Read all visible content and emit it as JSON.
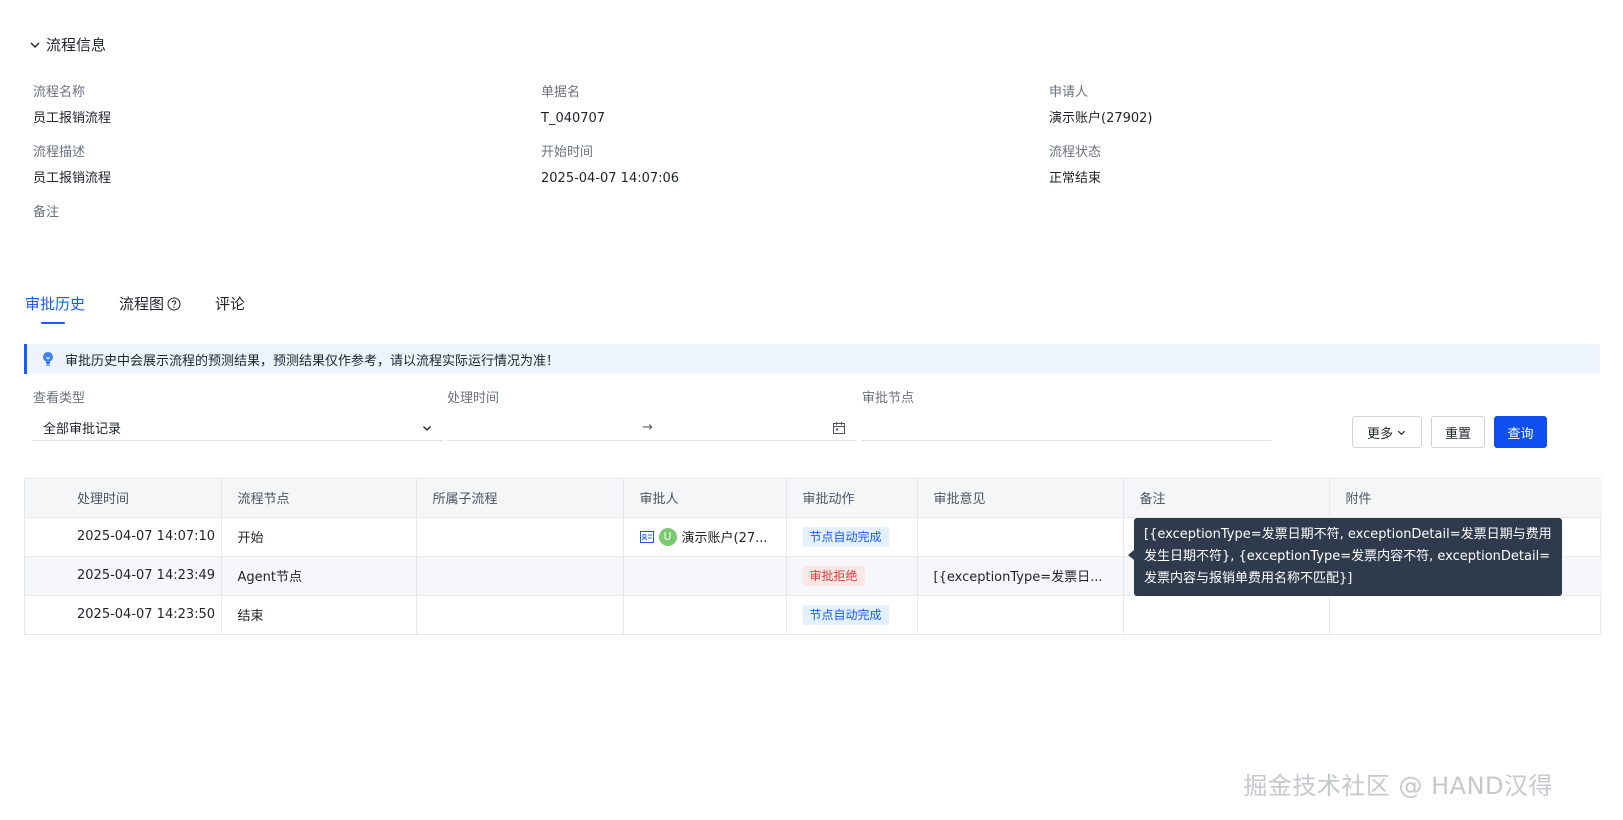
{
  "section": {
    "title": "流程信息",
    "icon": "chevron-down-icon"
  },
  "info": {
    "flow_name_label": "流程名称",
    "flow_name_value": "员工报销流程",
    "doc_name_label": "单据名",
    "doc_name_value": "T_040707",
    "applicant_label": "申请人",
    "applicant_value": "演示账户(27902)",
    "flow_desc_label": "流程描述",
    "flow_desc_value": "员工报销流程",
    "start_time_label": "开始时间",
    "start_time_value": "2025-04-07 14:07:06",
    "status_label": "流程状态",
    "status_value": "正常结束",
    "remark_label": "备注"
  },
  "tabs": [
    {
      "label": "审批历史",
      "active": true
    },
    {
      "label": "流程图",
      "icon": "help-circle-icon"
    },
    {
      "label": "评论"
    }
  ],
  "notice": {
    "icon": "lightbulb-icon",
    "text": "审批历史中会展示流程的预测结果，预测结果仅作参考，请以流程实际运行情况为准！"
  },
  "filters": {
    "view_type_label": "查看类型",
    "view_type_value": "全部审批记录",
    "process_time_label": "处理时间",
    "range_separator": "→",
    "node_label": "审批节点"
  },
  "buttons": {
    "more": "更多",
    "reset": "重置",
    "query": "查询"
  },
  "table": {
    "headers": [
      "处理时间",
      "流程节点",
      "所属子流程",
      "审批人",
      "审批动作",
      "审批意见",
      "备注",
      "附件"
    ],
    "rows": [
      {
        "time": "2025-04-07 14:07:10",
        "node": "开始",
        "subflow": "",
        "approver": "演示账户(27...",
        "avatar": "U",
        "action": "节点自动完成",
        "action_color": "blue",
        "opinion": "",
        "remark": "",
        "attachment": ""
      },
      {
        "time": "2025-04-07 14:23:49",
        "node": "Agent节点",
        "subflow": "",
        "approver": "",
        "avatar": "",
        "action": "审批拒绝",
        "action_color": "red",
        "opinion": "[{exceptionType=发票日...",
        "remark": "",
        "attachment": ""
      },
      {
        "time": "2025-04-07 14:23:50",
        "node": "结束",
        "subflow": "",
        "approver": "",
        "avatar": "",
        "action": "节点自动完成",
        "action_color": "blue",
        "opinion": "",
        "remark": "",
        "attachment": ""
      }
    ]
  },
  "tooltip": {
    "text": "[{exceptionType=发票日期不符, exceptionDetail=发票日期与费用发生日期不符}, {exceptionType=发票内容不符, exceptionDetail=发票内容与报销单费用名称不匹配}]"
  },
  "watermark": "掘金技术社区 @ HAND汉得",
  "colors": {
    "accent": "#1a5bf5",
    "primary_button": "#0f4ff0",
    "tag_blue_bg": "#e3f0fd",
    "tag_red_bg": "#fde6e6",
    "tooltip_bg": "#2f3a4d"
  }
}
